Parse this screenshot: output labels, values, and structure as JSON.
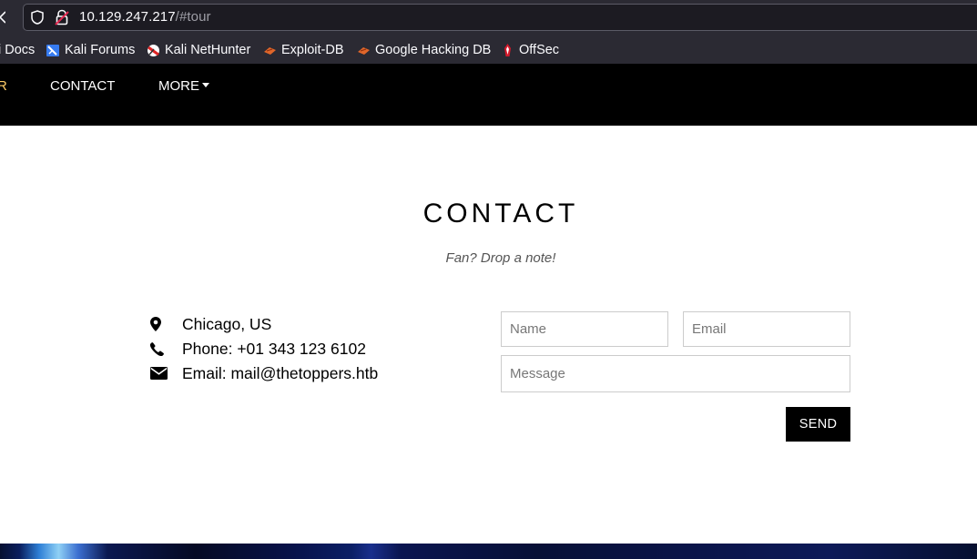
{
  "browser": {
    "url_host": "10.129.247.217",
    "url_path": "/#tour"
  },
  "bookmarks": [
    {
      "label": "i Docs",
      "icon": "kali-docs-icon"
    },
    {
      "label": "Kali Forums",
      "icon": "kali-forums-icon"
    },
    {
      "label": "Kali NetHunter",
      "icon": "kali-nethunter-icon"
    },
    {
      "label": "Exploit-DB",
      "icon": "exploit-db-icon"
    },
    {
      "label": "Google Hacking DB",
      "icon": "google-hacking-db-icon"
    },
    {
      "label": "OffSec",
      "icon": "offsec-icon"
    }
  ],
  "nav": {
    "partial_item": "R",
    "contact": "CONTACT",
    "more": "MORE"
  },
  "contact": {
    "title": "CONTACT",
    "subtitle": "Fan? Drop a note!",
    "location": "Chicago, US",
    "phone": "Phone: +01 343 123 6102",
    "email": "Email: mail@thetoppers.htb"
  },
  "form": {
    "name_placeholder": "Name",
    "email_placeholder": "Email",
    "message_placeholder": "Message",
    "send_label": "SEND"
  },
  "colors": {
    "navbar": "#000000",
    "browser_chrome": "#2b2a33",
    "send_button": "#000000"
  }
}
